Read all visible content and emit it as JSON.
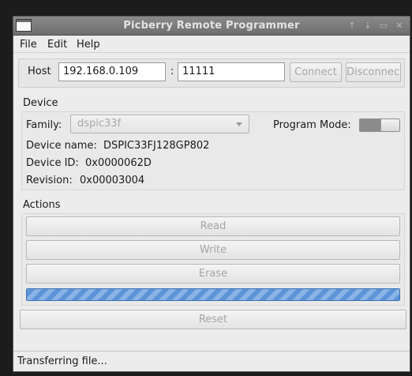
{
  "window": {
    "title": "Picberry Remote Programmer"
  },
  "titlebar_buttons": [
    "↑",
    "↓",
    "▭",
    "✕"
  ],
  "menu": {
    "file": "File",
    "edit": "Edit",
    "help": "Help"
  },
  "host": {
    "label": "Host",
    "ip": "192.168.0.109",
    "separator": ":",
    "port": "11111",
    "connect_label": "Connect",
    "disconnect_label": "Disconnect"
  },
  "device": {
    "section_title": "Device",
    "family_label": "Family:",
    "family_value": "dspic33f",
    "program_mode_label": "Program Mode:",
    "program_mode_on": true,
    "name_label": "Device name:",
    "name_value": "DSPIC33FJ128GP802",
    "id_label": "Device ID:",
    "id_value": "0x0000062D",
    "revision_label": "Revision:",
    "revision_value": "0x00003004"
  },
  "actions": {
    "section_title": "Actions",
    "read_label": "Read",
    "write_label": "Write",
    "erase_label": "Erase",
    "progress_fraction": 1.0,
    "reset_label": "Reset"
  },
  "status": {
    "text": "Transferring file..."
  },
  "colors": {
    "progress_border": "#3b6fb3",
    "progress_fill": "#5d94d8",
    "disabled_text": "#a6a6a6"
  }
}
